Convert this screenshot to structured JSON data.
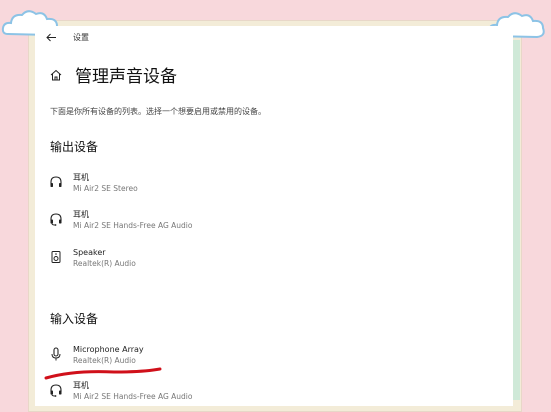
{
  "window": {
    "title": "设置"
  },
  "page": {
    "title": "管理声音设备",
    "description": "下面是你所有设备的列表。选择一个想要启用或禁用的设备。"
  },
  "output_section": {
    "title": "输出设备",
    "devices": [
      {
        "name": "耳机",
        "detail": "Mi Air2 SE Stereo",
        "icon": "headphones-icon"
      },
      {
        "name": "耳机",
        "detail": "Mi Air2 SE Hands-Free AG Audio",
        "icon": "headset-icon"
      },
      {
        "name": "Speaker",
        "detail": "Realtek(R) Audio",
        "icon": "speaker-icon"
      }
    ]
  },
  "input_section": {
    "title": "输入设备",
    "devices": [
      {
        "name": "Microphone Array",
        "detail": "Realtek(R) Audio",
        "icon": "microphone-icon"
      },
      {
        "name": "耳机",
        "detail": "Mi Air2 SE Hands-Free AG Audio",
        "icon": "headset-icon"
      }
    ]
  },
  "colors": {
    "background": "#f8d8dc",
    "annotation": "#d0101a",
    "frame": "#f3ecd8"
  }
}
